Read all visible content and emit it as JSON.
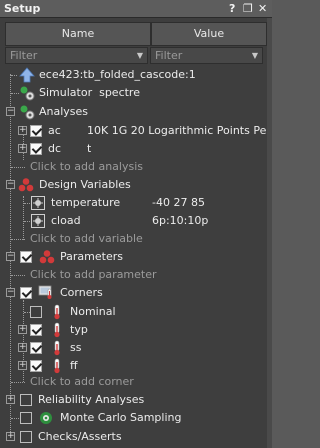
{
  "titlebar": {
    "title": "Setup",
    "help": "?",
    "float": "❐",
    "close": "✕"
  },
  "header": {
    "name": "Name",
    "value": "Value"
  },
  "filters": {
    "name_placeholder": "Filter",
    "value_placeholder": "Filter"
  },
  "tree": {
    "root": "ece423:tb_folded_cascode:1",
    "simulator": {
      "label": "Simulator",
      "value": "spectre"
    },
    "analyses": {
      "label": "Analyses",
      "items": [
        {
          "name": "ac",
          "value": "10K 1G 20 Logarithmic Points Per ..."
        },
        {
          "name": "dc",
          "value": "t"
        }
      ],
      "add_hint": "Click to add analysis"
    },
    "design_variables": {
      "label": "Design Variables",
      "items": [
        {
          "name": "temperature",
          "value": "-40 27 85"
        },
        {
          "name": "cload",
          "value": "6p:10:10p"
        }
      ],
      "add_hint": "Click to add variable"
    },
    "parameters": {
      "label": "Parameters",
      "add_hint": "Click to add parameter"
    },
    "corners": {
      "label": "Corners",
      "items": [
        {
          "name": "Nominal"
        },
        {
          "name": "typ"
        },
        {
          "name": "ss"
        },
        {
          "name": "ff"
        }
      ],
      "add_hint": "Click to add corner"
    },
    "reliability": {
      "label": "Reliability Analyses"
    },
    "monte_carlo": {
      "label": "Monte Carlo Sampling"
    },
    "checks": {
      "label": "Checks/Asserts"
    }
  },
  "colors": {
    "panel": "#3e3e3e",
    "title": "#5d5d5d",
    "header": "#555555"
  }
}
